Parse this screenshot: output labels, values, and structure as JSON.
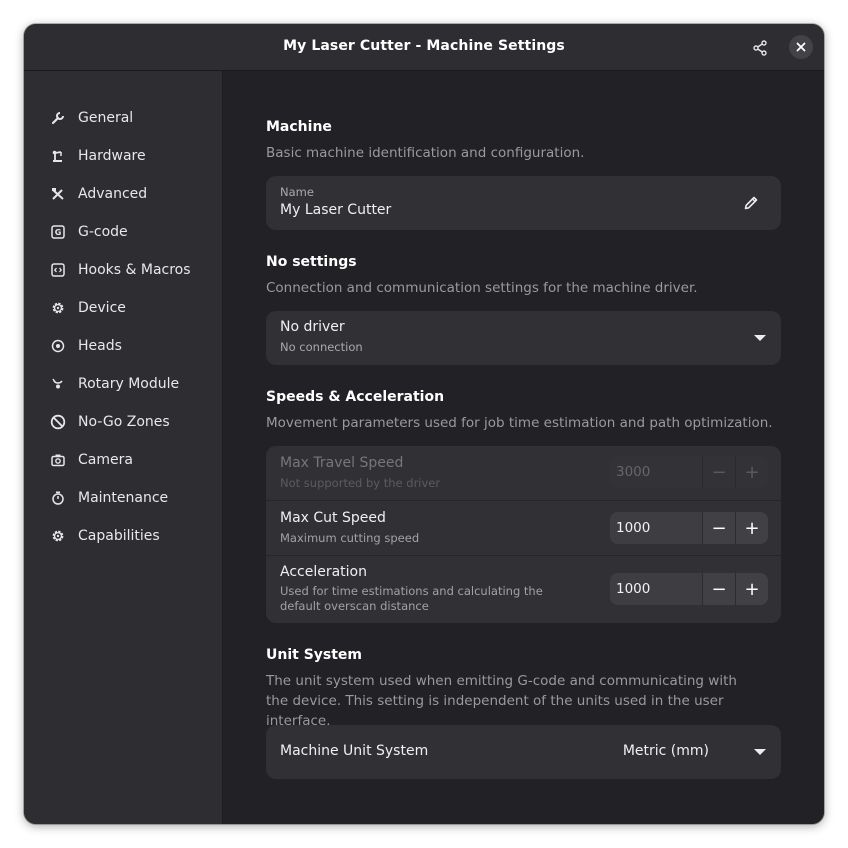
{
  "window": {
    "title": "My Laser Cutter - Machine Settings"
  },
  "header": {
    "share_icon": "share-icon",
    "close_icon": "close-icon"
  },
  "sidebar": {
    "items": [
      {
        "label": "General",
        "icon": "wrench-icon"
      },
      {
        "label": "Hardware",
        "icon": "laser-arm-icon"
      },
      {
        "label": "Advanced",
        "icon": "tools-icon"
      },
      {
        "label": "G-code",
        "icon": "gcode-icon"
      },
      {
        "label": "Hooks & Macros",
        "icon": "code-icon"
      },
      {
        "label": "Device",
        "icon": "gear-icon"
      },
      {
        "label": "Heads",
        "icon": "target-icon"
      },
      {
        "label": "Rotary Module",
        "icon": "rotary-icon"
      },
      {
        "label": "No-Go Zones",
        "icon": "prohibited-icon"
      },
      {
        "label": "Camera",
        "icon": "camera-icon"
      },
      {
        "label": "Maintenance",
        "icon": "stopwatch-icon"
      },
      {
        "label": "Capabilities",
        "icon": "gear-icon"
      }
    ]
  },
  "machine": {
    "title": "Machine",
    "description": "Basic machine identification and configuration.",
    "name_label": "Name",
    "name_value": "My Laser Cutter",
    "edit_icon": "pencil-icon"
  },
  "driver": {
    "title": "No settings",
    "description": "Connection and communication settings for the machine driver.",
    "selected": "No driver",
    "status": "No connection"
  },
  "speeds": {
    "title": "Speeds & Acceleration",
    "description": "Movement parameters used for job time estimation and path optimization.",
    "rows": [
      {
        "title": "Max Travel Speed",
        "subtitle": "Not supported by the driver",
        "value": "3000",
        "disabled": true
      },
      {
        "title": "Max Cut Speed",
        "subtitle": "Maximum cutting speed",
        "value": "1000",
        "disabled": false
      },
      {
        "title": "Acceleration",
        "subtitle": "Used for time estimations and calculating the default overscan distance",
        "value": "1000",
        "disabled": false
      }
    ],
    "minus_label": "−",
    "plus_label": "+"
  },
  "units": {
    "title": "Unit System",
    "description": "The unit system used when emitting G-code and communicating with the device. This setting is independent of the units used in the user interface.",
    "row_label": "Machine Unit System",
    "selected": "Metric (mm)"
  },
  "colors": {
    "window_bg": "#222226",
    "sidebar_bg": "#2e2e32",
    "card_bg": "#313135",
    "text_primary": "#ffffff",
    "text_secondary": "#9a9a9e"
  }
}
